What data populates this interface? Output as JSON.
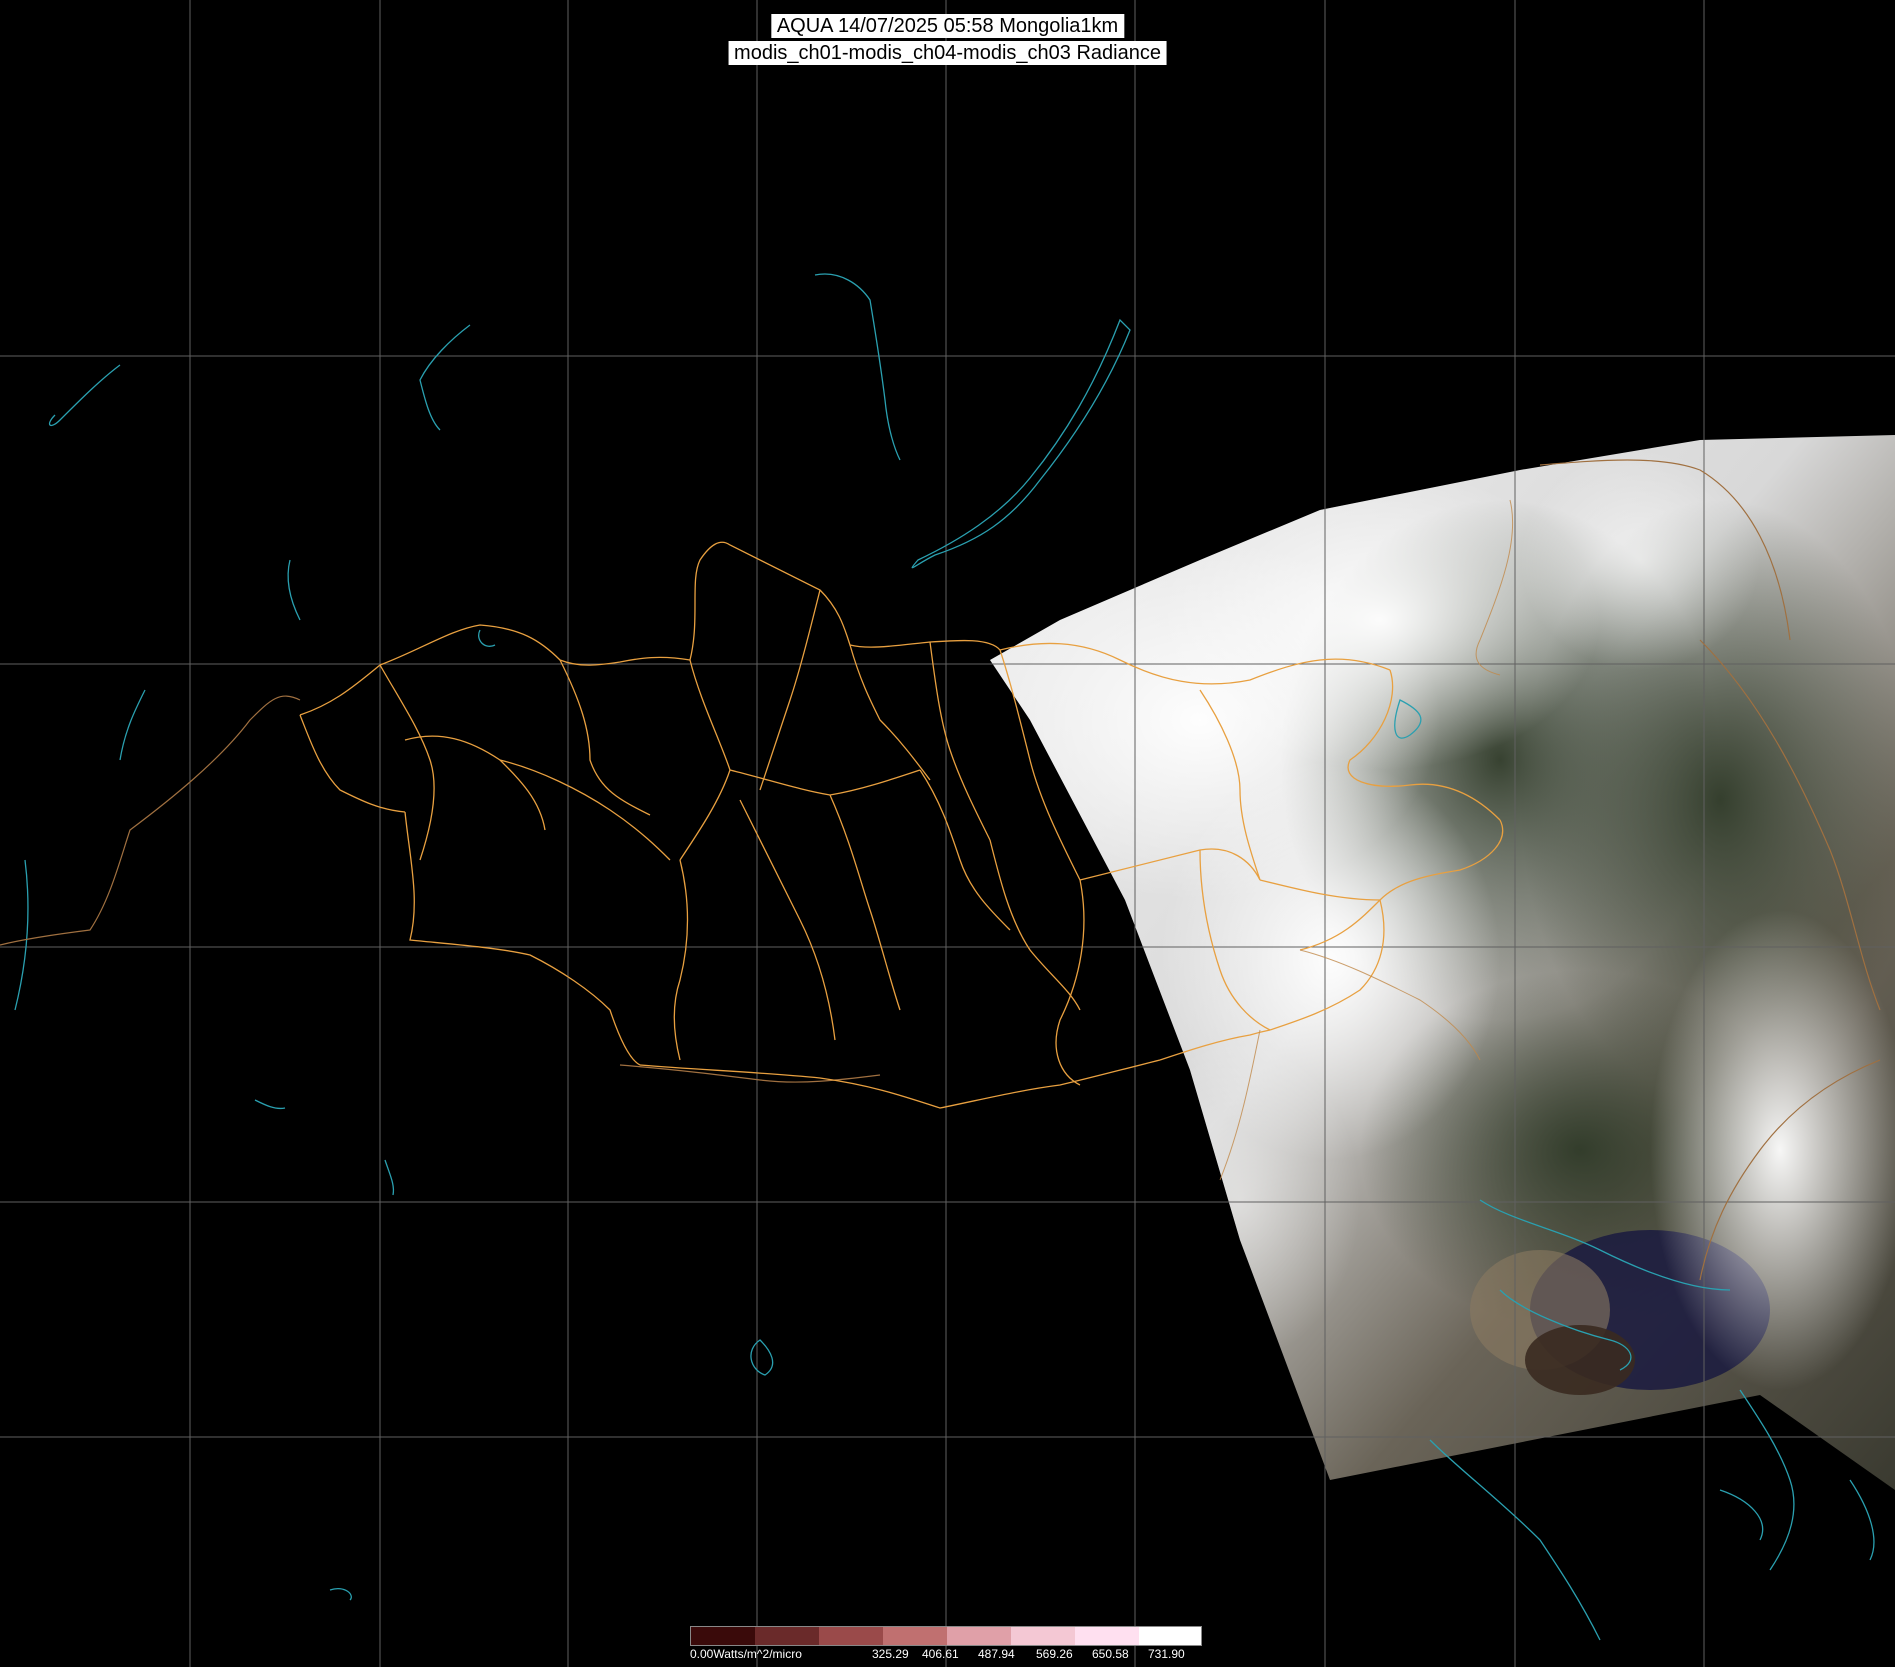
{
  "header": {
    "line1": "AQUA 14/07/2025 05:58 Mongolia1km",
    "line2": "modis_ch01-modis_ch04-modis_ch03 Radiance"
  },
  "legend": {
    "min_label": "0.00Watts/m^2/micro",
    "tick_labels": [
      "325.29",
      "406.61",
      "487.94",
      "569.26",
      "650.58",
      "731.90"
    ],
    "colors": [
      "#3a0a0a",
      "#6a2a2a",
      "#9a4a4a",
      "#c07070",
      "#e0a0a8",
      "#f4c8d4",
      "#ffe0f0",
      "#ffffff"
    ]
  },
  "map_colors": {
    "background": "#000000",
    "grid": "#606060",
    "coastline": "#2aa0b0",
    "admin_border": "#e8a040",
    "country_border": "#a07040"
  }
}
